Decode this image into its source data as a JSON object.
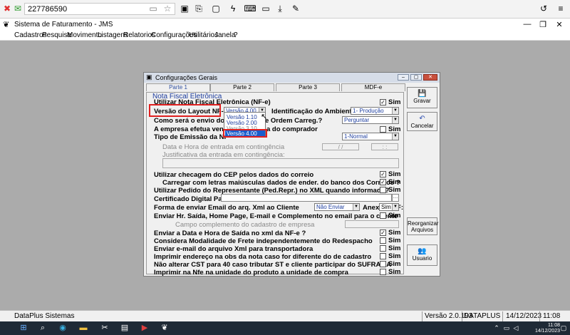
{
  "remote": {
    "id": "227786590"
  },
  "app": {
    "title": "Sistema de Faturamento - JMS",
    "menu": [
      "Cadastros",
      "Pesquisa",
      "Movimento",
      "Listagens",
      "Relatorios",
      "Configurações",
      "Utilitários",
      "Janela",
      "?"
    ]
  },
  "dialog": {
    "title": "Configurações Gerais",
    "tabs": [
      "Parte 1",
      "Parte 2",
      "Parte 3",
      "MDF-e"
    ],
    "group_title": "Nota Fiscal Eletrônica",
    "rows": {
      "utilizar_nfe": "Utilizar Nota Fiscal Eletrônica (NF-e)",
      "versao_layout": "Versão do Layout NF-e",
      "versao_value": "Versão 4.00",
      "identificacao_ambiente": "Identificação do Ambiente.:",
      "ambiente_value": "1- Produção",
      "envio": "Como será o envio dos a",
      "envio_tail": "e Ordem Carreg.?",
      "envio_value": "Perguntar",
      "empresa": "A empresa efetua venda",
      "empresa_tail": "a do comprador",
      "tipo_emissao": "Tipo de Emissão da NF-",
      "tipo_value": "1-Normal",
      "contingencia_data": "Data e Hora de entrada em contingência",
      "date_placeholder": "/ /",
      "time_placeholder": ": :",
      "contingencia_just": "Justificativa da entrada em contingência:",
      "cep": "Utilizar checagem do CEP pelos dados do correio",
      "maiusculas": "Carregar com letras maiúsculas dados de ender. do banco dos Correios ?",
      "pedido": "Utilizar Pedido do Representante (Ped.Repr.) no XML quando informado?",
      "certificado": "Certificado Digital Padrão",
      "email_forma": "Forma de enviar Email do arq. Xml ao Cliente",
      "email_value": "Não Enviar",
      "anexar_pdf": "Anexar PDF:",
      "anexar_value": "Sim",
      "enviar_hr": "Enviar Hr. Saída, Home Page, E-mail e Complemento no email para o cliente",
      "campo_complemento": "Campo complemento do cadastro de empresa",
      "enviar_data": "Enviar a Data e Hora de Saída no xml da NF-e ?",
      "modalidade": "Considera Modalidade de Frete independentemente do Redespacho",
      "email_transp": "Enviar e-mail do arquivo Xml para transportadora",
      "imprimir_end": "Imprimir endereço na obs da nota caso for diferente do de cadastro",
      "nao_alterar": "Não alterar CST para 40 caso tributar ST e cliente participar do SUFRAMA",
      "imprimir_unid": "Imprimir na Nfe na unidade do produto a unidade de compra"
    },
    "sim": "Sim",
    "dropdown_options": [
      "Versão 1.10",
      "Versão 2.00",
      "Versão 3.10",
      "Versão 4.00"
    ],
    "buttons": {
      "gravar": "Gravar",
      "cancelar": "Cancelar",
      "reorganizar": "Reorganizar Arquivos",
      "usuario": "Usuario"
    }
  },
  "status": {
    "company": "DataPlus Sistemas",
    "version": "Versão 2.0.193",
    "user": "DATAPLUS",
    "date": "14/12/2023",
    "time": "11:08"
  },
  "taskbar": {
    "time": "11:08",
    "date": "14/12/2023"
  }
}
